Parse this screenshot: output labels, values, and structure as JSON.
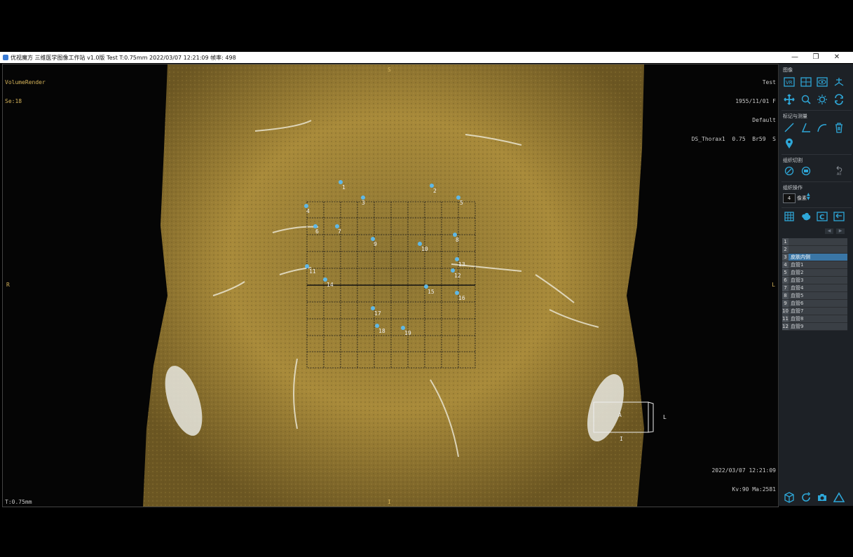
{
  "window": {
    "title": "优视魔方 三维医学图像工作站 v1.0版 Test T:0.75mm 2022/03/07 12:21:09 帧率: 498",
    "minimize": "—",
    "maximize": "❐",
    "close": "✕"
  },
  "viewport": {
    "top_left": [
      "VolumeRender",
      "Se:18"
    ],
    "top_right": [
      "Test",
      "1955/11/01 F",
      "Default",
      "DS_Thorax1  0.75  Br59  S"
    ],
    "bottom_left": "T:0.75mm",
    "bottom_right": [
      "2022/03/07 12:21:09",
      "Kv:90 Ma:2581"
    ],
    "orientation": {
      "top": "S",
      "bottom": "I",
      "left": "R",
      "right": "L"
    },
    "cube": {
      "front": "A",
      "side": "L",
      "bottom": "I"
    },
    "markers": [
      "1",
      "2",
      "3",
      "4",
      "5",
      "6",
      "7",
      "8",
      "9",
      "10",
      "11",
      "12",
      "13",
      "14",
      "15",
      "16",
      "17",
      "18",
      "19"
    ],
    "colors": {
      "tissue": "#a88a3a",
      "marker": "#5fb8e6",
      "grid": "#1a1a1a"
    }
  },
  "panel": {
    "section_image": "图像",
    "section_marks": "标记与测量",
    "section_tissue": "组织切割",
    "section_ops": "组织操作",
    "pixel_value": "4",
    "pixel_unit": "像素",
    "icons_row1": [
      "vr-icon",
      "mpr-icon",
      "eye-icon",
      "axes-icon"
    ],
    "icons_row2": [
      "move-icon",
      "zoom-icon",
      "brightness-icon",
      "rotate-icon"
    ],
    "icons_marks": [
      "line-measure-icon",
      "angle-measure-icon",
      "curve-measure-icon",
      "trash-icon"
    ],
    "icons_tissue": [
      "scissors-icon",
      "cut-region-icon",
      "undo-all-icon"
    ],
    "undo_all_label": "All",
    "icons_ops": [
      "grid-icon",
      "blob-icon",
      "c-icon",
      "reset-icon"
    ],
    "tissue_list": [
      {
        "num": "1",
        "name": "",
        "dim": true
      },
      {
        "num": "2",
        "name": "",
        "dim": true
      },
      {
        "num": "3",
        "name": "皮肤内侧",
        "selected": true
      },
      {
        "num": "4",
        "name": "血管1"
      },
      {
        "num": "5",
        "name": "血管2"
      },
      {
        "num": "6",
        "name": "血管3"
      },
      {
        "num": "7",
        "name": "血管4"
      },
      {
        "num": "8",
        "name": "血管5"
      },
      {
        "num": "9",
        "name": "血管6"
      },
      {
        "num": "10",
        "name": "血管7"
      },
      {
        "num": "11",
        "name": "血管8"
      },
      {
        "num": "12",
        "name": "血管9"
      }
    ],
    "bottom_icons": [
      "cube-icon",
      "refresh-icon",
      "camera-icon",
      "triangle-icon"
    ],
    "accent": "#2ea7d8"
  }
}
